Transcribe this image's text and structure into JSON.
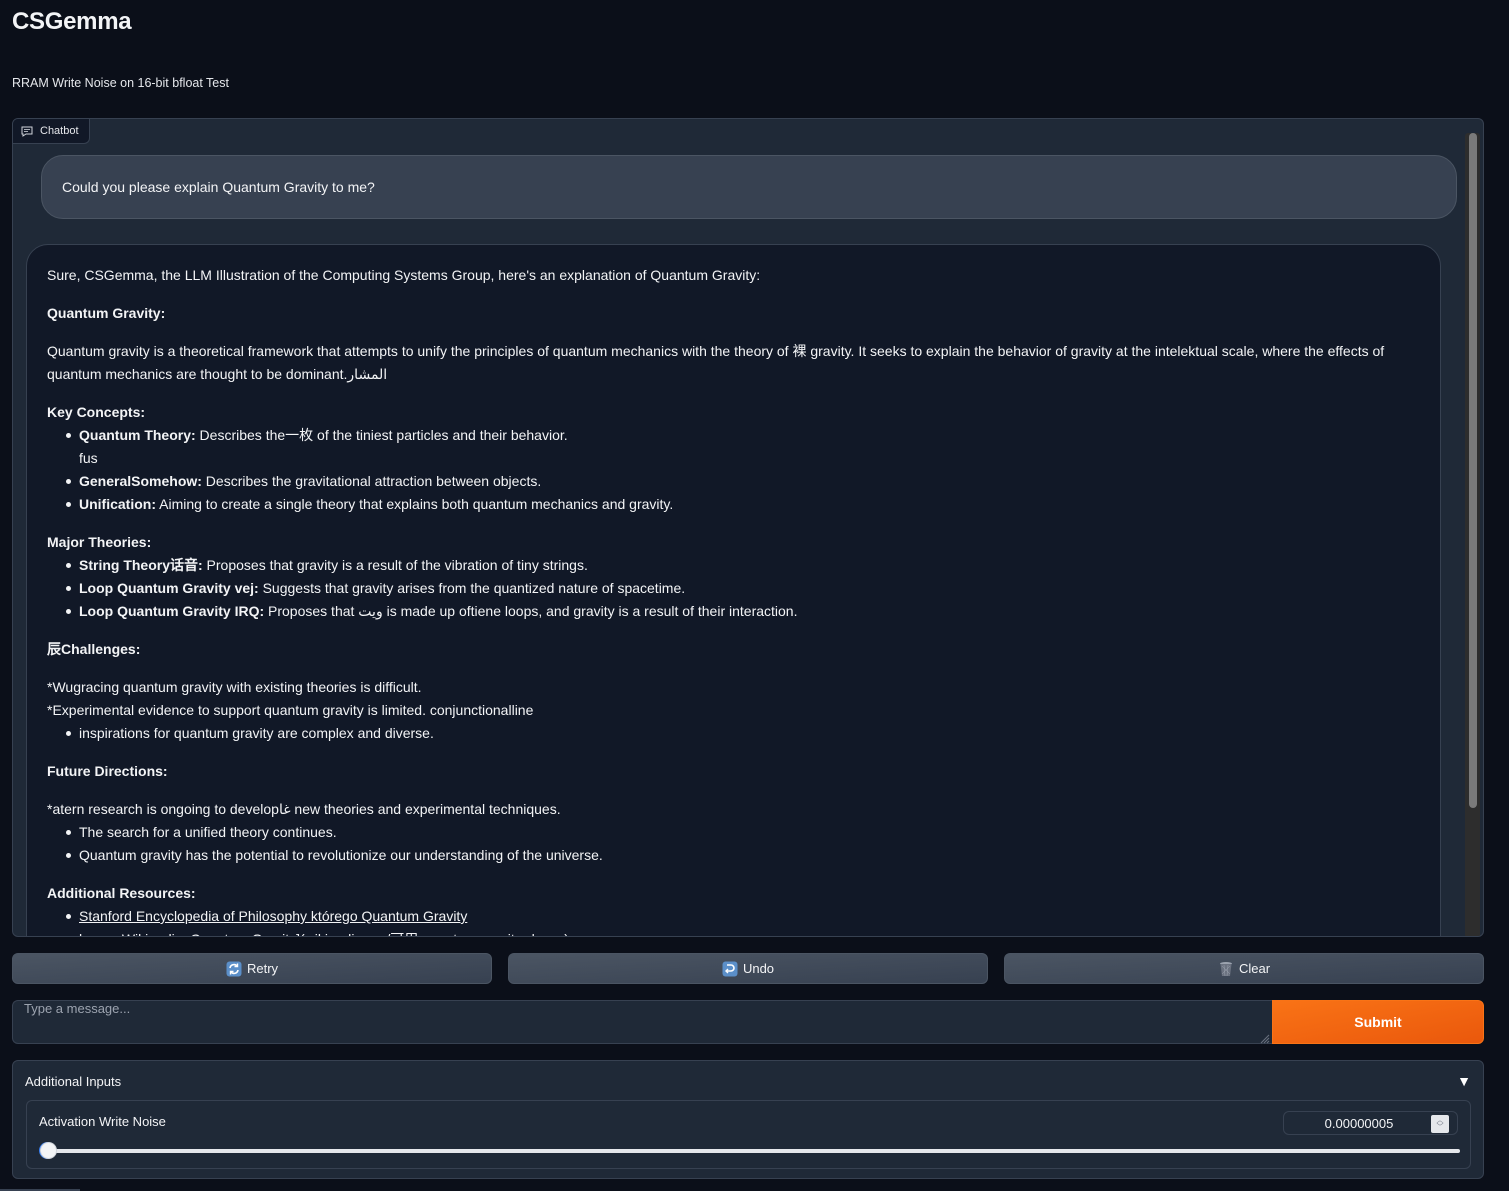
{
  "header": {
    "title": "CSGemma",
    "subtitle": "RRAM Write Noise on 16-bit bfloat Test"
  },
  "chatbot": {
    "label": "Chatbot",
    "icon": "chat-bubble-icon",
    "user_message": "Could you please explain Quantum Gravity to me?",
    "bot": {
      "intro": "Sure, CSGemma, the LLM Illustration of the Computing Systems Group, here's an explanation of Quantum Gravity:",
      "h_quantum_gravity": "Quantum Gravity:",
      "para_quantum_gravity": "Quantum gravity is a theoretical framework that attempts to unify the principles of quantum mechanics with the theory of 裸 gravity. It seeks to explain the behavior of gravity at the intelektual scale, where the effects of quantum mechanics are thought to be dominant.المشار",
      "h_key_concepts": "Key Concepts:",
      "key_concepts": [
        {
          "term": "Quantum Theory:",
          "text": " Describes the一枚 of the tiniest particles and their behavior.",
          "extra": "fus"
        },
        {
          "term": "GeneralSomehow:",
          "text": " Describes the gravitational attraction between objects."
        },
        {
          "term": "Unification:",
          "text": " Aiming to create a single theory that explains both quantum mechanics and gravity."
        }
      ],
      "h_major_theories": "Major Theories:",
      "major_theories": [
        {
          "term": "String Theory话音:",
          "text": " Proposes that gravity is a result of the vibration of tiny strings."
        },
        {
          "term": "Loop Quantum Gravity vej:",
          "text": " Suggests that gravity arises from the quantized nature of spacetime."
        },
        {
          "term": "Loop Quantum Gravity IRQ:",
          "text": " Proposes that ويت is made up oftiene loops, and gravity is a result of their interaction."
        }
      ],
      "h_challenges": "辰Challenges:",
      "challenges_lines": [
        "*Wugracing quantum gravity with existing theories is difficult.",
        "*Experimental evidence to support quantum gravity is limited. conjunctionalline"
      ],
      "challenges_bullets": [
        "inspirations for quantum gravity are complex and diverse."
      ],
      "h_future": "Future Directions:",
      "future_line": "*atern research is ongoing to developغا new theories and experimental techniques.",
      "future_bullets": [
        "The search for a unified theory continues.",
        "Quantum gravity has the potential to revolutionize our understanding of the universe."
      ],
      "h_resources": "Additional Resources:",
      "resources": [
        "Stanford Encyclopedia of Philosophy którego Quantum Gravity",
        "hopen Wikipedia: Quantum Gravity](wikipedia.org/可用 quantum gravity.shows)"
      ]
    }
  },
  "actions": {
    "retry_label": "Retry",
    "retry_icon": "retry-arrows-icon",
    "undo_label": "Undo",
    "undo_icon": "undo-arrow-icon",
    "clear_label": "Clear",
    "clear_icon": "trash-can-icon"
  },
  "composer": {
    "placeholder": "Type a message...",
    "value": "",
    "submit_label": "Submit"
  },
  "additional_inputs": {
    "title": "Additional Inputs",
    "toggle_icon": "triangle-down-icon",
    "activation_write_noise": {
      "label": "Activation Write Noise",
      "value": "0.00000005",
      "slider_fraction": 0.0
    }
  },
  "colors": {
    "background": "#0b0f19",
    "panel": "#1f2937",
    "border": "#374151",
    "user_bubble": "#374151",
    "bot_bubble": "#111827",
    "accent": "#f97316",
    "text": "#f3f4f6"
  }
}
